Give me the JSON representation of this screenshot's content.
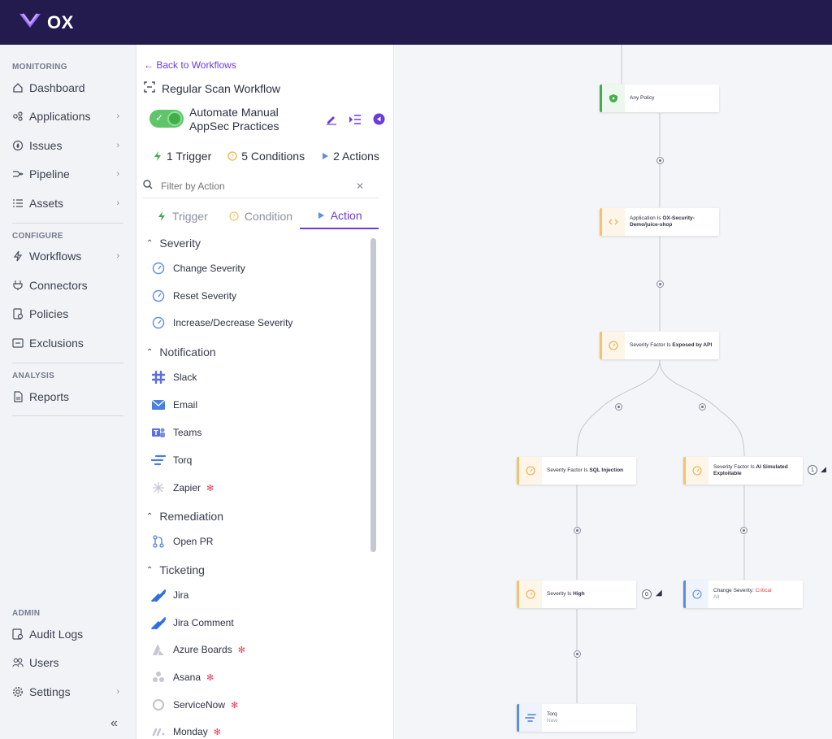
{
  "brand": {
    "name": "OX"
  },
  "sidebar": {
    "sections": [
      {
        "title": "MONITORING",
        "items": [
          {
            "label": "Dashboard"
          },
          {
            "label": "Applications"
          },
          {
            "label": "Issues"
          },
          {
            "label": "Pipeline"
          },
          {
            "label": "Assets"
          }
        ]
      },
      {
        "title": "CONFIGURE",
        "items": [
          {
            "label": "Workflows"
          },
          {
            "label": "Connectors"
          },
          {
            "label": "Policies"
          },
          {
            "label": "Exclusions"
          }
        ]
      },
      {
        "title": "ANALYSIS",
        "items": [
          {
            "label": "Reports"
          }
        ]
      },
      {
        "title": "ADMIN",
        "items": [
          {
            "label": "Audit Logs"
          },
          {
            "label": "Users"
          },
          {
            "label": "Settings"
          }
        ]
      }
    ],
    "collapse_icon": "double-chevron-left-icon"
  },
  "panel": {
    "back_label": "Back to Workflows",
    "workflow_title": "Regular Scan Workflow",
    "automate_label": "Automate Manual AppSec Practices",
    "counts": {
      "trigger": "1 Trigger",
      "conditions": "5 Conditions",
      "actions": "2 Actions"
    },
    "filter_placeholder": "Filter by Action",
    "tabs": {
      "trigger": "Trigger",
      "condition": "Condition",
      "action": "Action"
    },
    "groups": {
      "severity": {
        "title": "Severity",
        "items": [
          "Change Severity",
          "Reset Severity",
          "Increase/Decrease Severity"
        ]
      },
      "notification": {
        "title": "Notification",
        "items": [
          "Slack",
          "Email",
          "Teams",
          "Torq",
          "Zapier"
        ]
      },
      "remediation": {
        "title": "Remediation",
        "items": [
          "Open PR"
        ]
      },
      "ticketing": {
        "title": "Ticketing",
        "items": [
          "Jira",
          "Jira Comment",
          "Azure Boards",
          "Asana",
          "ServiceNow",
          "Monday"
        ]
      }
    }
  },
  "canvas": {
    "nodes": {
      "any_policy": {
        "label": "Any Policy"
      },
      "application": {
        "prefix": "Application Is ",
        "value": "OX-Security-Demo/juice-shop"
      },
      "sev_factor_api": {
        "prefix": "Severity Factor Is ",
        "value": "Exposed by API"
      },
      "sev_factor_sql": {
        "prefix": "Severity Factor Is ",
        "value": "SQL Injection"
      },
      "sev_factor_ai": {
        "prefix": "Severity Factor Is ",
        "value": "AI Simulated Exploitable"
      },
      "severity_high": {
        "prefix": "Severity Is ",
        "value": "High"
      },
      "change_severity": {
        "prefix": "Change Severity: ",
        "value": "Critical",
        "sub": "All"
      },
      "torq": {
        "label": "Torq",
        "sub": "New"
      }
    },
    "badges": {
      "ai": "1",
      "high": "0"
    },
    "colors": {
      "accent": "#6a3cdc",
      "trigger": "#3fae4b",
      "condition": "#f5c26b",
      "action": "#5b8de0"
    }
  }
}
